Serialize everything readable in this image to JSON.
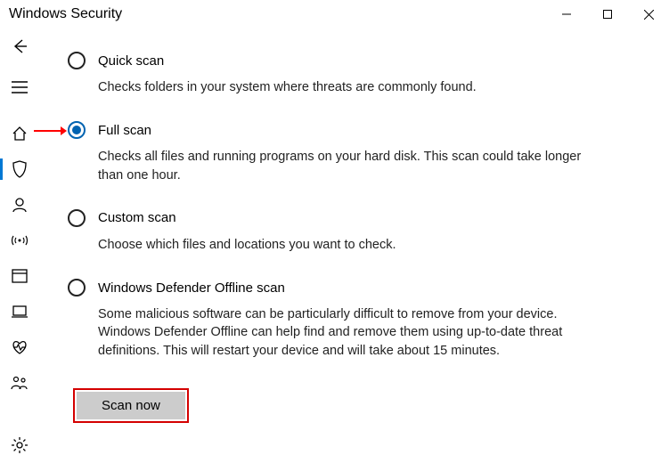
{
  "window": {
    "title": "Windows Security"
  },
  "options": {
    "quick": {
      "label": "Quick scan",
      "desc": "Checks folders in your system where threats are commonly found."
    },
    "full": {
      "label": "Full scan",
      "desc": "Checks all files and running programs on your hard disk. This scan could take longer than one hour."
    },
    "custom": {
      "label": "Custom scan",
      "desc": "Choose which files and locations you want to check."
    },
    "offline": {
      "label": "Windows Defender Offline scan",
      "desc": "Some malicious software can be particularly difficult to remove from your device. Windows Defender Offline can help find and remove them using up-to-date threat definitions. This will restart your device and will take about 15 minutes."
    }
  },
  "selected_option": "full",
  "button": {
    "scan_now": "Scan now"
  },
  "annotations": {
    "arrow_target": "full",
    "highlight_target": "scan_now"
  }
}
